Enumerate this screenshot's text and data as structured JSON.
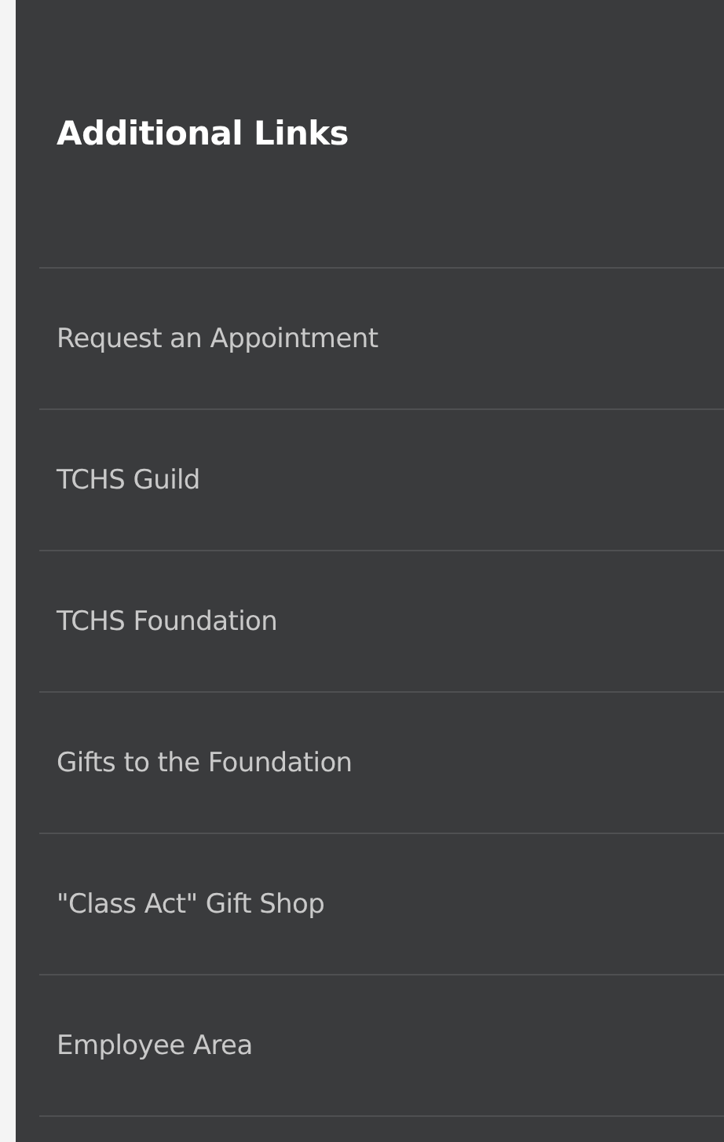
{
  "heading": "Additional Links",
  "links": [
    "Request an Appointment",
    "TCHS Guild",
    "TCHS Foundation",
    "Gifts to the Foundation",
    "\"Class Act\" Gift Shop",
    "Employee Area"
  ]
}
